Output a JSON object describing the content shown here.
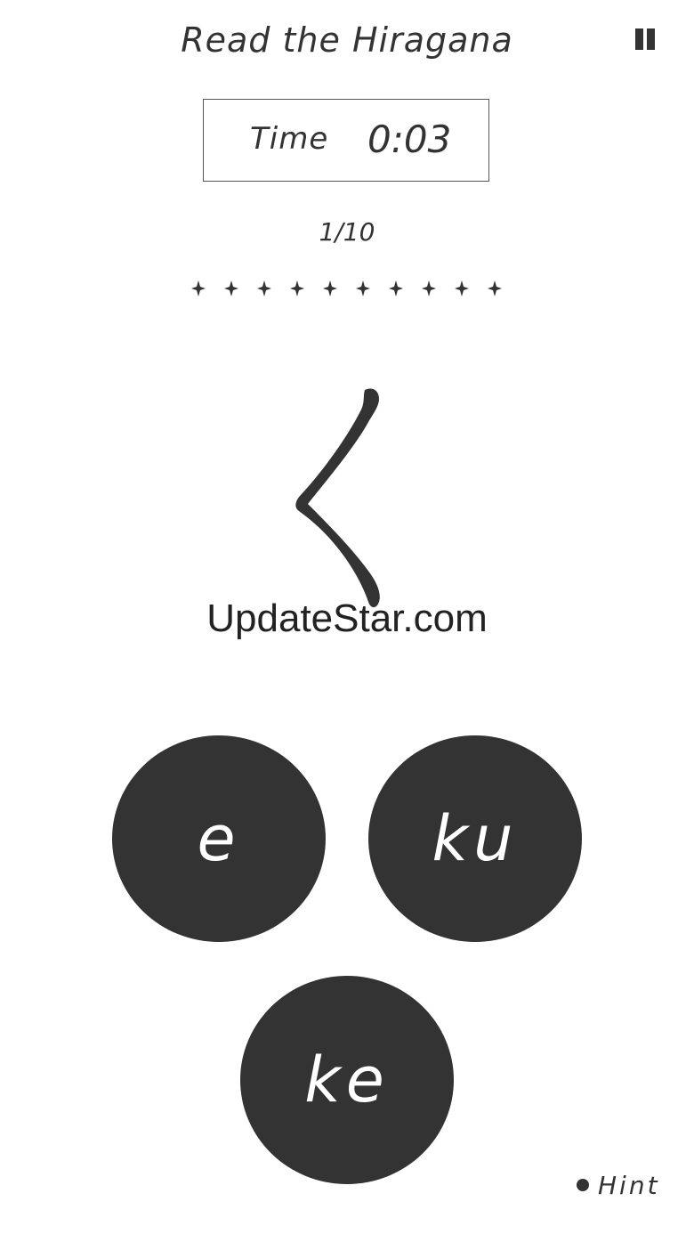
{
  "header": {
    "title": "Read the Hiragana",
    "pause_icon": "pause-icon"
  },
  "timer": {
    "label": "Time",
    "value": "0:03"
  },
  "progress": {
    "count_text": "1/10",
    "total_markers": 10,
    "marker_icon": "four-point-star-icon"
  },
  "question": {
    "kana": "く"
  },
  "watermark": {
    "text": "UpdateStar.com"
  },
  "choices": [
    {
      "label": "e"
    },
    {
      "label": "ku"
    },
    {
      "label": "ke"
    }
  ],
  "hint": {
    "label": "Hint"
  },
  "colors": {
    "dark": "#333333",
    "background": "#ffffff",
    "choice_text": "#ffffff"
  }
}
